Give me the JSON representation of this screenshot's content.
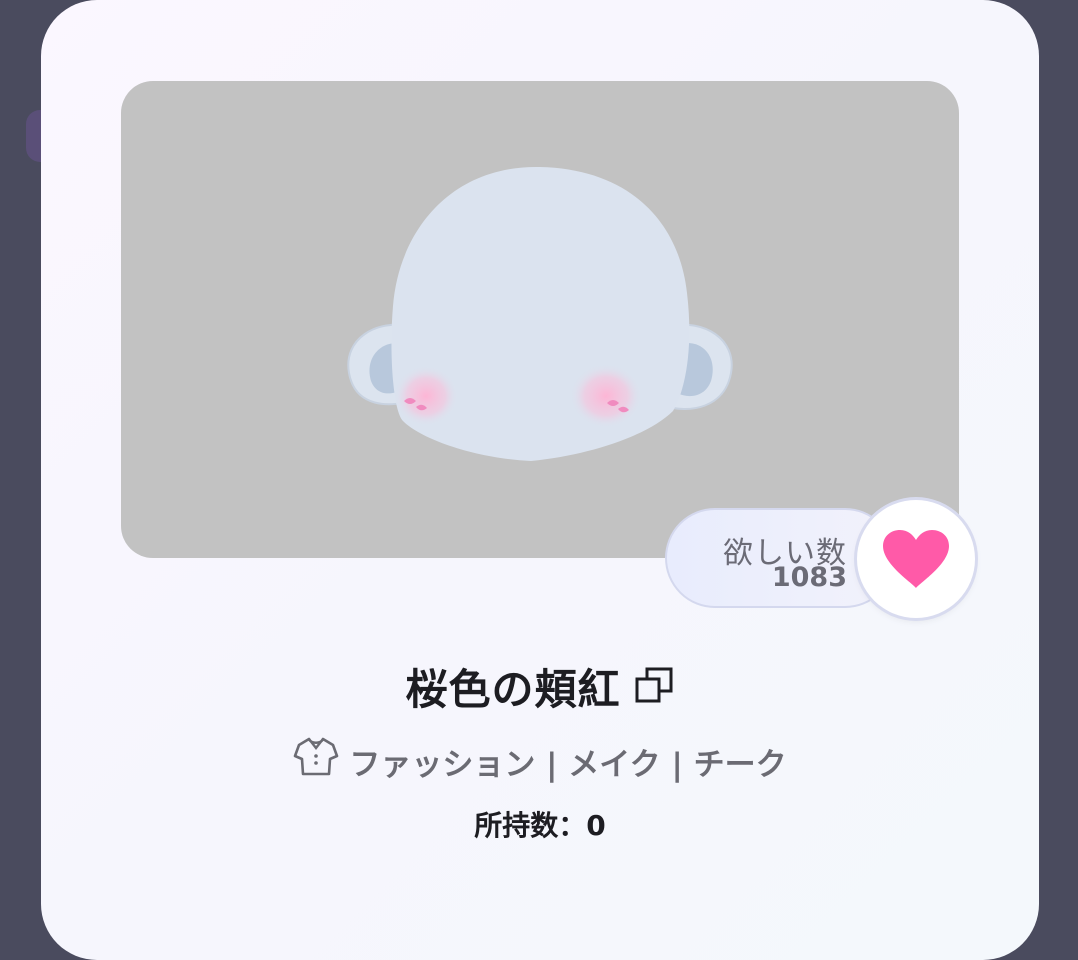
{
  "item": {
    "name": "桜色の頬紅",
    "wish_label": "欲しい数",
    "wish_count": "1083",
    "category": "ファッション | メイク | チーク",
    "owned": "所持数：0"
  },
  "colors": {
    "heart": "#ff5aa8",
    "preview_bg": "#c2c2c2"
  },
  "icons": [
    "copy-icon",
    "shirt-icon",
    "heart-icon"
  ]
}
